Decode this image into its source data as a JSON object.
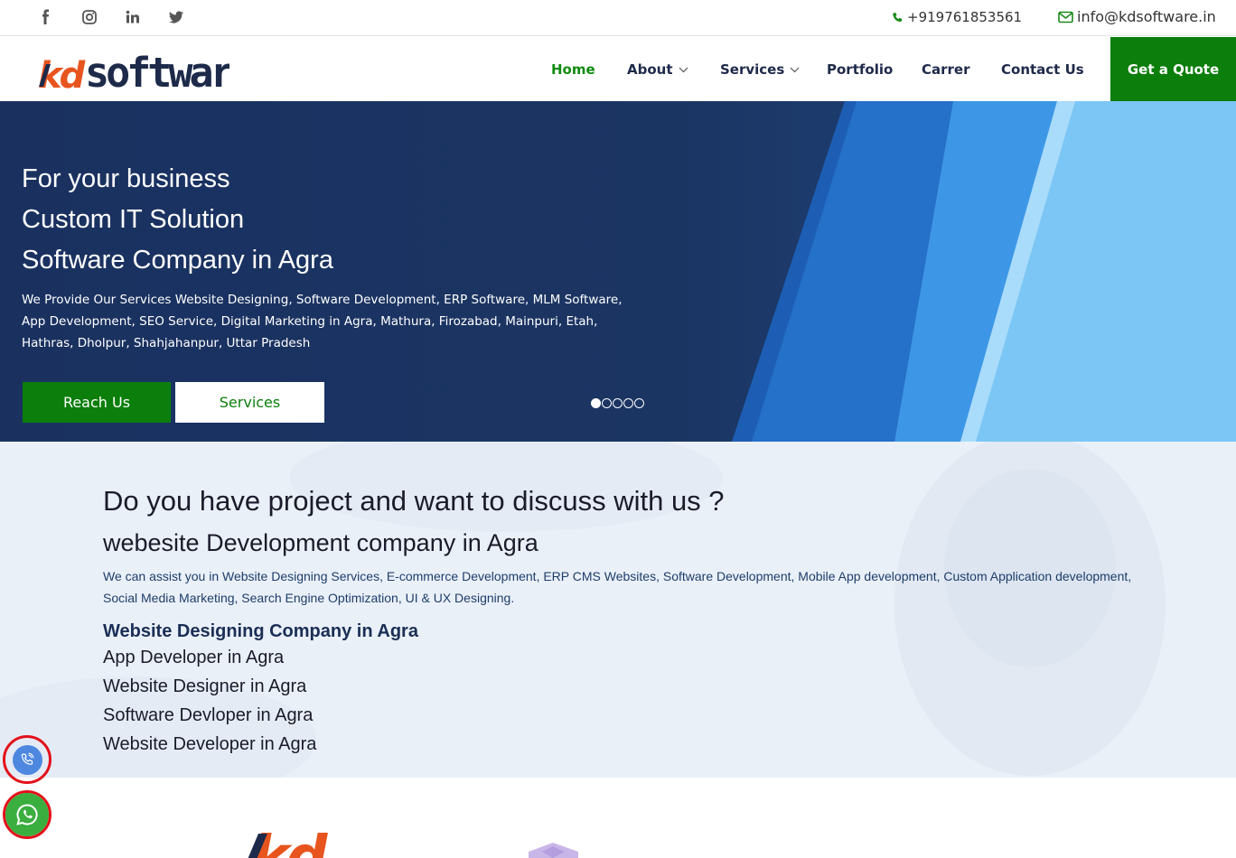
{
  "topbar": {
    "social": [
      "facebook-icon",
      "instagram-icon",
      "linkedin-icon",
      "twitter-icon"
    ],
    "phone": "+919761853561",
    "email": "info@kdsoftware.in"
  },
  "header": {
    "logo": {
      "mark": "kd",
      "word": "software"
    },
    "nav": {
      "home": "Home",
      "about": "About",
      "services": "Services",
      "portfolio": "Portfolio",
      "carrer": "Carrer",
      "contact": "Contact Us"
    },
    "quote": "Get a Quote"
  },
  "hero": {
    "line1": "For your business",
    "line2": "Custom IT Solution",
    "line3": "Software Company in Agra",
    "desc": "We Provide Our Services Website Designing, Software Development, ERP Software, MLM Software, App Development, SEO Service, Digital Marketing in Agra, Mathura, Firozabad, Mainpuri, Etah, Hathras, Dholpur, Shahjahanpur, Uttar Pradesh",
    "btn_reach": "Reach Us",
    "btn_services": "Services",
    "slides": 5,
    "active_slide": 1
  },
  "section2": {
    "heading": "Do you have project and want to discuss with us ?",
    "subheading": "webesite Development company in Agra",
    "paragraph": "We can assist you in Website Designing Services, E-commerce Development, ERP CMS Websites, Software Development, Mobile App development, Custom Application development, Social Media Marketing, Search Engine Optimization, UI & UX Designing.",
    "bold_heading": "Website Designing Company in Agra",
    "list": [
      "App Developer in Agra",
      "Website Designer in Agra",
      "Software Devloper in Agra",
      "Website Developer in Agra"
    ]
  },
  "colors": {
    "brand_green": "#0b7e0b",
    "navy": "#1a3160",
    "accent_orange": "#e8541e",
    "float_ring": "#e3101a"
  },
  "floating": {
    "call": "phone-call-icon",
    "whatsapp": "whatsapp-icon"
  }
}
